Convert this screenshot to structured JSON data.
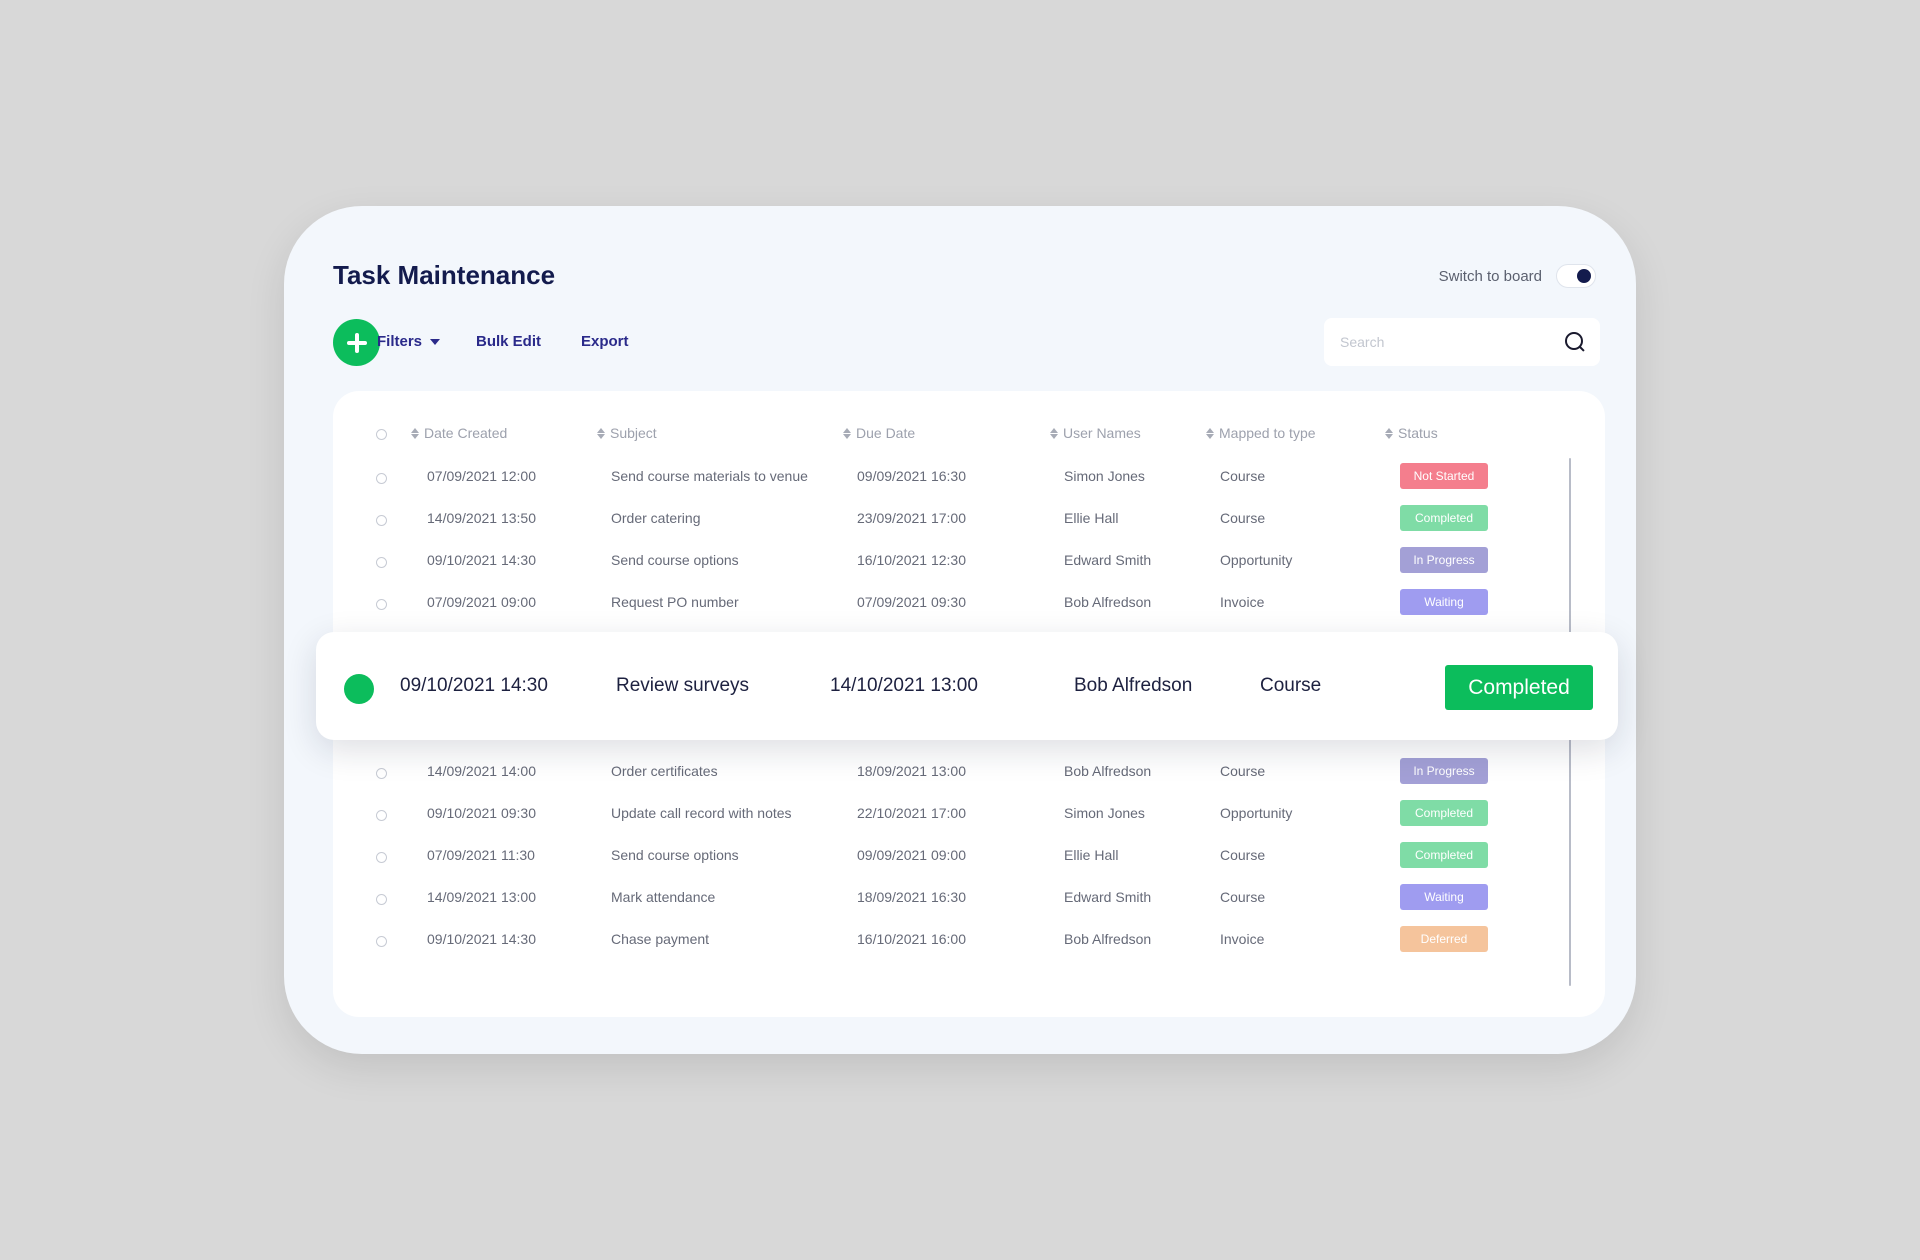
{
  "header": {
    "title": "Task Maintenance",
    "switch_label": "Switch to board"
  },
  "toolbar": {
    "filters_label": "Filters",
    "bulk_edit_label": "Bulk Edit",
    "export_label": "Export",
    "search_placeholder": "Search"
  },
  "table": {
    "columns": [
      "Date Created",
      "Subject",
      "Due Date",
      "User Names",
      "Mapped to type",
      "Status"
    ],
    "rows_top": [
      {
        "date_created": "07/09/2021  12:00",
        "subject": "Send course materials to venue",
        "due_date": "09/09/2021  16:30",
        "user": "Simon Jones",
        "type": "Course",
        "status": "Not Started"
      },
      {
        "date_created": "14/09/2021  13:50",
        "subject": "Order catering",
        "due_date": "23/09/2021  17:00",
        "user": "Ellie Hall",
        "type": "Course",
        "status": "Completed"
      },
      {
        "date_created": "09/10/2021  14:30",
        "subject": "Send course options",
        "due_date": "16/10/2021  12:30",
        "user": "Edward Smith",
        "type": "Opportunity",
        "status": "In Progress"
      },
      {
        "date_created": "07/09/2021  09:00",
        "subject": "Request PO number",
        "due_date": "07/09/2021  09:30",
        "user": "Bob Alfredson",
        "type": "Invoice",
        "status": "Waiting"
      }
    ],
    "highlighted_row": {
      "date_created": "09/10/2021  14:30",
      "subject": "Review surveys",
      "due_date": "14/10/2021  13:00",
      "user": "Bob Alfredson",
      "type": "Course",
      "status": "Completed"
    },
    "rows_bottom": [
      {
        "date_created": "14/09/2021  14:00",
        "subject": "Order certificates",
        "due_date": "18/09/2021  13:00",
        "user": "Bob Alfredson",
        "type": "Course",
        "status": "In Progress"
      },
      {
        "date_created": "09/10/2021  09:30",
        "subject": "Update call record with notes",
        "due_date": "22/10/2021  17:00",
        "user": "Simon Jones",
        "type": "Opportunity",
        "status": "Completed"
      },
      {
        "date_created": "07/09/2021  11:30",
        "subject": "Send course options",
        "due_date": "09/09/2021  09:00",
        "user": "Ellie Hall",
        "type": "Course",
        "status": "Completed"
      },
      {
        "date_created": "14/09/2021  13:00",
        "subject": "Mark attendance",
        "due_date": "18/09/2021  16:30",
        "user": "Edward Smith",
        "type": "Course",
        "status": "Waiting"
      },
      {
        "date_created": "09/10/2021  14:30",
        "subject": "Chase payment",
        "due_date": "16/10/2021  16:00",
        "user": "Bob Alfredson",
        "type": "Invoice",
        "status": "Deferred"
      }
    ]
  },
  "status_colors": {
    "Not Started": "#f47e8d",
    "Completed": "#7fdca6",
    "In Progress": "#a3a0d6",
    "Waiting": "#9f9cf0",
    "Deferred": "#f5c49c",
    "Highlight": "#0cbd5c"
  },
  "colors": {
    "accent_green": "#0cbd5c",
    "title_navy": "#131b4d",
    "link_indigo": "#2a2a8a"
  }
}
